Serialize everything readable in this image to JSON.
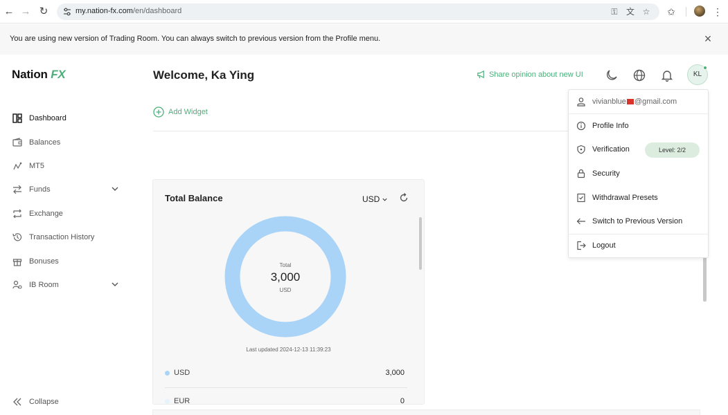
{
  "browser": {
    "url_host": "my.nation-fx.com",
    "url_path": "/en/dashboard"
  },
  "notice": {
    "message": "You are using new version of Trading Room. You can always switch to previous version from the Profile menu.",
    "close_icon": "close-icon"
  },
  "logo": {
    "text_main": "Nation ",
    "text_fx": "FX"
  },
  "sidebar": {
    "items": [
      {
        "label": "Dashboard",
        "icon": "dashboard-icon",
        "active": true
      },
      {
        "label": "Balances",
        "icon": "wallet-icon"
      },
      {
        "label": "MT5",
        "icon": "mt5-icon"
      },
      {
        "label": "Funds",
        "icon": "transfer-icon",
        "expandable": true
      },
      {
        "label": "Exchange",
        "icon": "exchange-icon"
      },
      {
        "label": "Transaction History",
        "icon": "history-icon"
      },
      {
        "label": "Bonuses",
        "icon": "gift-icon"
      },
      {
        "label": "IB Room",
        "icon": "ib-room-icon",
        "expandable": true
      }
    ],
    "collapse_label": "Collapse"
  },
  "header": {
    "welcome": "Welcome, Ka Ying",
    "share_opinion": "Share opinion about new UI",
    "avatar_initials": "KL"
  },
  "add_widget_label": "Add Widget",
  "balance_card": {
    "title": "Total Balance",
    "currency": "USD",
    "donut_label": "Total",
    "donut_value": "3,000",
    "donut_unit": "USD",
    "last_updated": "Last updated 2024-12-13 11:39:23",
    "rows": [
      {
        "currency": "USD",
        "value": "3,000",
        "color": "#aad4f7"
      },
      {
        "currency": "EUR",
        "value": "0",
        "color": "#e6f3fb"
      }
    ]
  },
  "profile_menu": {
    "email_prefix": "vivianblue",
    "email_suffix": "@gmail.com",
    "items": [
      {
        "label": "Profile Info",
        "icon": "info-icon"
      },
      {
        "label": "Verification",
        "icon": "shield-icon",
        "badge": "Level: 2/2"
      },
      {
        "label": "Security",
        "icon": "lock-icon"
      },
      {
        "label": "Withdrawal Presets",
        "icon": "checklist-icon"
      },
      {
        "label": "Switch to Previous Version",
        "icon": "arrow-left-icon"
      },
      {
        "label": "Logout",
        "icon": "logout-icon"
      }
    ]
  },
  "colors": {
    "accent": "#4caf7a",
    "donut": "#aad4f7"
  }
}
